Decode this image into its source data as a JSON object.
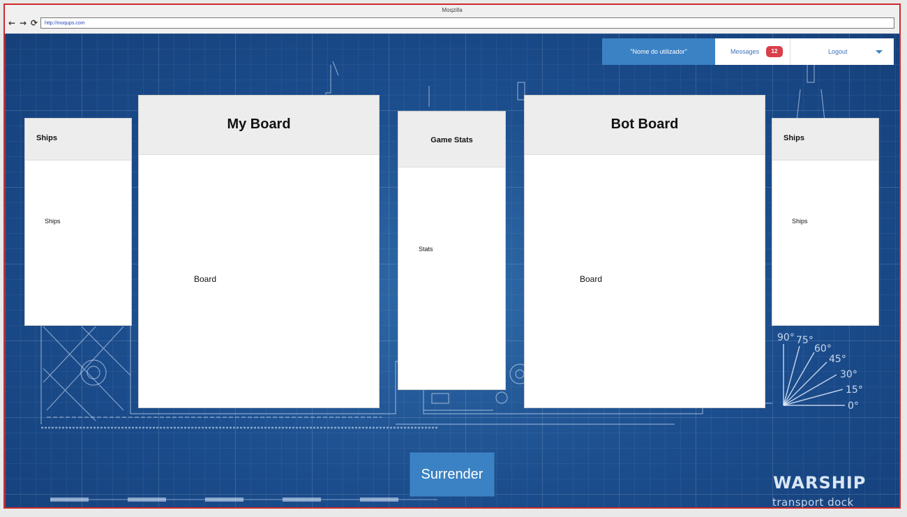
{
  "browser": {
    "title": "Moqzilla",
    "url": "http://moqups.com",
    "nav": {
      "back_icon": "←",
      "forward_icon": "→",
      "reload_icon": "⟳"
    }
  },
  "userbar": {
    "username": "\"Nome do utilizador\"",
    "messages_label": "Messages",
    "messages_count": "12",
    "logout_label": "Logout"
  },
  "left_ships": {
    "title": "Ships",
    "content": "Ships"
  },
  "my_board": {
    "title": "My Board",
    "content": "Board"
  },
  "game_stats": {
    "title": "Game Stats",
    "content": "Stats"
  },
  "bot_board": {
    "title": "Bot Board",
    "content": "Board"
  },
  "right_ships": {
    "title": "Ships",
    "content": "Ships"
  },
  "surrender_label": "Surrender",
  "protractor_labels": [
    "90°",
    "75°",
    "60°",
    "45°",
    "30°",
    "15°",
    "0°"
  ],
  "logo": {
    "main": "WARSHIP",
    "sub": "transport dock"
  },
  "colors": {
    "accent": "#3b82c4",
    "badge": "#d9404a",
    "background": "#1d4f8f"
  }
}
